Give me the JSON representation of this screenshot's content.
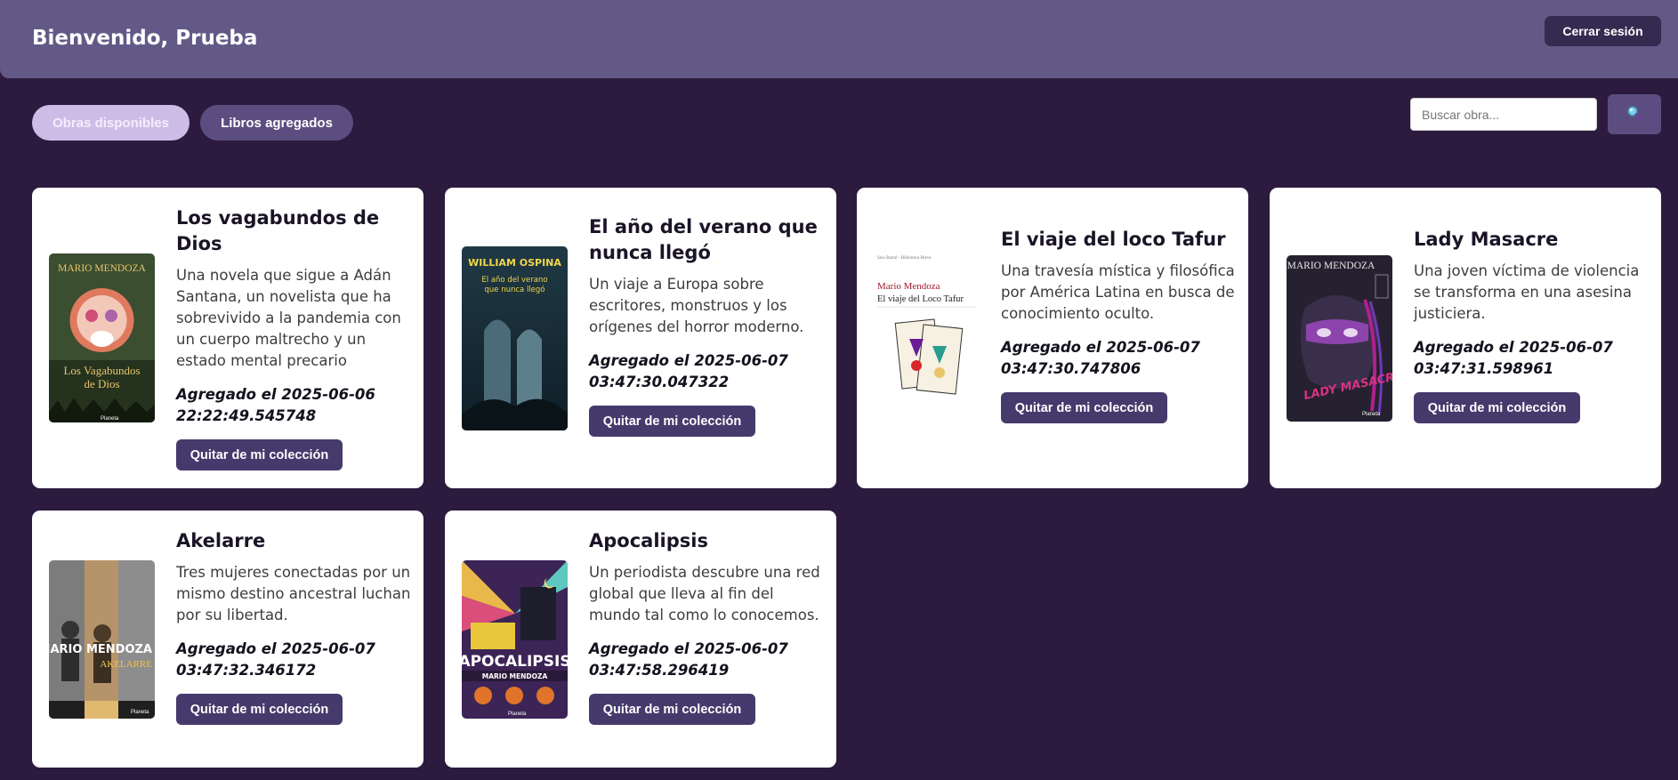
{
  "header": {
    "welcome": "Bienvenido, Prueba",
    "logout_label": "Cerrar sesión"
  },
  "tabs": [
    {
      "label": "Obras disponibles",
      "active": true
    },
    {
      "label": "Libros agregados",
      "active": false
    }
  ],
  "search": {
    "placeholder": "Buscar obra...",
    "value": "",
    "button_icon": "search-icon"
  },
  "books": [
    {
      "title": "Los vagabundos de Dios",
      "description": "Una novela que sigue a Adán Santana, un novelista que ha sobrevivido a la pandemia con un cuerpo maltrecho y un estado mental precario",
      "added": "Agregado el 2025-06-06 22:22:49.545748",
      "button": "Quitar de mi colección",
      "cover": {
        "author": "MARIO MENDOZA",
        "title": "Los Vagabundos de Dios",
        "publisher": "Planeta"
      }
    },
    {
      "title": "El año del verano que nunca llegó",
      "description": "Un viaje a Europa sobre escritores, monstruos y los orígenes del horror moderno.",
      "added": "Agregado el 2025-06-07 03:47:30.047322",
      "button": "Quitar de mi colección",
      "cover": {
        "author": "WILLIAM OSPINA",
        "title": "El año del verano que nunca llegó"
      }
    },
    {
      "title": "El viaje del loco Tafur",
      "description": "Una travesía mística y filosófica por América Latina en busca de conocimiento oculto.",
      "added": "Agregado el 2025-06-07 03:47:30.747806",
      "button": "Quitar de mi colección",
      "cover": {
        "author": "Mario Mendoza",
        "title": "El viaje del Loco Tafur"
      }
    },
    {
      "title": "Lady Masacre",
      "description": "Una joven víctima de violencia se transforma en una asesina justiciera.",
      "added": "Agregado el 2025-06-07 03:47:31.598961",
      "button": "Quitar de mi colección",
      "cover": {
        "author": "MARIO MENDOZA",
        "title": "LADY MASACRE",
        "publisher": "Planeta"
      }
    },
    {
      "title": "Akelarre",
      "description": "Tres mujeres conectadas por un mismo destino ancestral luchan por su libertad.",
      "added": "Agregado el 2025-06-07 03:47:32.346172",
      "button": "Quitar de mi colección",
      "cover": {
        "author": "MARIO MENDOZA",
        "title": "AKELARRE",
        "publisher": "Planeta"
      }
    },
    {
      "title": "Apocalipsis",
      "description": "Un periodista descubre una red global que lleva al fin del mundo tal como lo conocemos.",
      "added": "Agregado el 2025-06-07 03:47:58.296419",
      "button": "Quitar de mi colección",
      "cover": {
        "author": "MARIO MENDOZA",
        "title": "APOCALIPSIS",
        "publisher": "Planeta"
      }
    }
  ],
  "colors": {
    "background": "#2c1a3f",
    "header": "#635987",
    "accent_button": "#453a6b",
    "card": "#ffffff"
  }
}
